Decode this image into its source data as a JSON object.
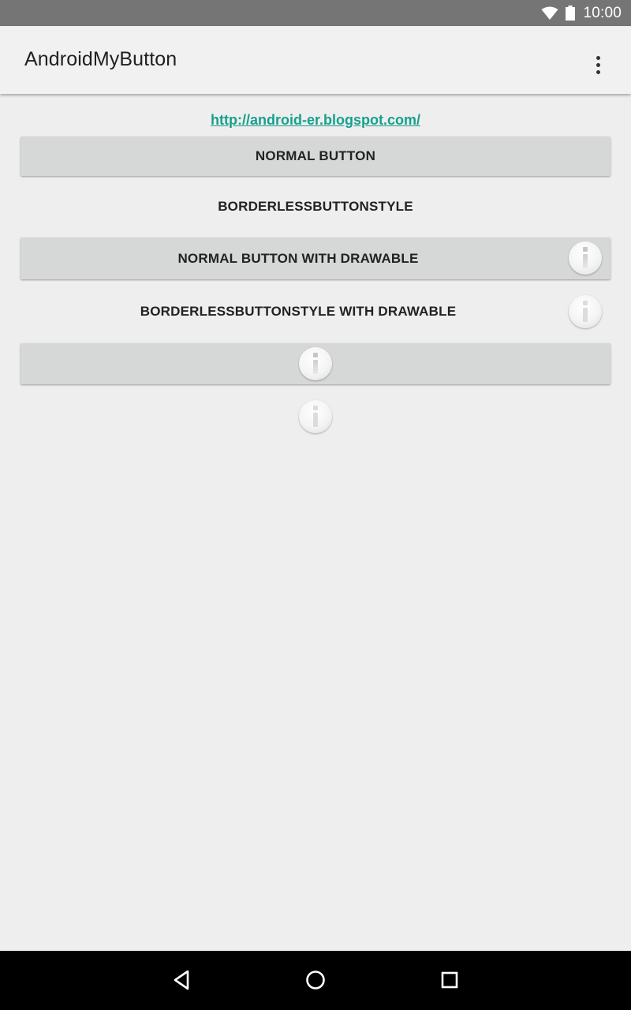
{
  "status_bar": {
    "time": "10:00",
    "icons": [
      "wifi-icon",
      "battery-icon"
    ]
  },
  "app_bar": {
    "title": "AndroidMyButton",
    "overflow_icon": "more-vert-icon"
  },
  "content": {
    "link_text": "http://android-er.blogspot.com/",
    "buttons": [
      {
        "label": "NORMAL BUTTON",
        "style": "raised",
        "drawable": null
      },
      {
        "label": "BORDERLESSBUTTONSTYLE",
        "style": "borderless",
        "drawable": null
      },
      {
        "label": "NORMAL BUTTON WITH DRAWABLE",
        "style": "raised",
        "drawable": "info-icon"
      },
      {
        "label": "BORDERLESSBUTTONSTYLE WITH DRAWABLE",
        "style": "borderless",
        "drawable": "info-icon"
      },
      {
        "label": "",
        "style": "raised",
        "drawable": "info-icon"
      },
      {
        "label": "",
        "style": "borderless",
        "drawable": "info-icon"
      }
    ]
  },
  "nav_bar": {
    "icons": [
      "back-icon",
      "home-icon",
      "recents-icon"
    ]
  },
  "colors": {
    "status_bar": "#757575",
    "app_bar": "#f1f1f1",
    "background": "#eeeeee",
    "link": "#16a08d",
    "raised_button": "#d6d7d7",
    "nav_bar": "#000000"
  }
}
